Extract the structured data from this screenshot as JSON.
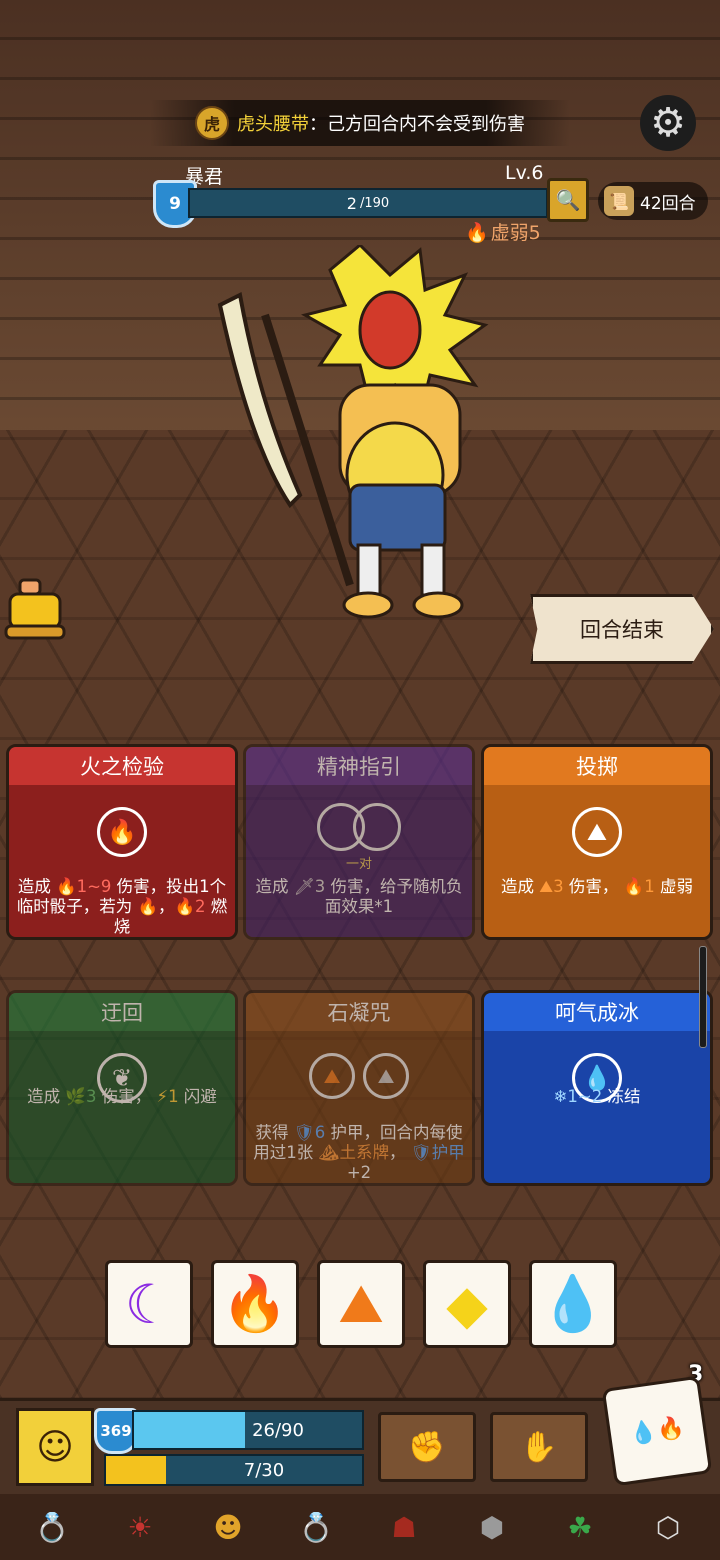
{
  "effect_banner": {
    "item_name": "虎头腰带",
    "separator": "：",
    "text": "己方回合内不会受到伤害"
  },
  "enemy": {
    "name": "暴君",
    "level": "Lv.6",
    "armor": "9",
    "hp_current": "2",
    "hp_max": "/190",
    "hp_fraction": 0.0105,
    "debuff": "虚弱5"
  },
  "turn_counter": "42回合",
  "end_turn_label": "回合结束",
  "cards": [
    {
      "title": "火之检验",
      "color": "#c63430",
      "icon": "fire-icon",
      "desc": [
        "造成 ",
        {
          "v": "1~9",
          "c": "hl-red",
          "i": "🔥"
        },
        " 伤害，投出1个临时骰子，若为 ",
        {
          "v": "",
          "c": "hl-red",
          "i": "🔥"
        },
        "，",
        {
          "v": "2",
          "c": "hl-red",
          "i": "🔥"
        },
        " 燃烧"
      ]
    },
    {
      "title": "精神指引",
      "color": "#5a2f8e",
      "icon": "pair-icon",
      "sub": "一对",
      "desc": [
        "造成 ",
        {
          "v": "3",
          "c": "hl-gray",
          "i": "🗡"
        },
        " 伤害，给予随机负面效果*1"
      ]
    },
    {
      "title": "投掷",
      "color": "#e1791f",
      "icon": "earth-icon",
      "desc": [
        "造成 ",
        {
          "v": "3",
          "c": "hl-or",
          "i": "⛰"
        },
        " 伤害， ",
        {
          "v": "1",
          "c": "hl-or",
          "i": "🔥"
        },
        " 虚弱"
      ]
    },
    {
      "title": "迂回",
      "color": "#1f7a3a",
      "icon": "wind-icon",
      "desc": [
        "造成 ",
        {
          "v": "3",
          "c": "hl-grn",
          "i": "🌿"
        },
        " 伤害， ",
        {
          "v": "1",
          "c": "hl-yel",
          "i": "⚡"
        },
        " 闪避"
      ]
    },
    {
      "title": "石凝咒",
      "color": "#8a4e1d",
      "icon": "earth-stone-icon",
      "desc": [
        "获得 ",
        {
          "v": "6",
          "c": "hl-blu",
          "i": "🛡"
        },
        " 护甲，回合内每使用过1张 ",
        {
          "v": "土系牌",
          "c": "hl-or",
          "i": "⛰"
        },
        "， ",
        {
          "v": "护甲",
          "c": "hl-blu",
          "i": "🛡"
        },
        " +2"
      ]
    },
    {
      "title": "呵气成冰",
      "color": "#2561d8",
      "icon": "water-icon",
      "desc": [
        {
          "v": "1~2",
          "c": "hl-ice",
          "i": "❄"
        },
        " 冻结"
      ]
    }
  ],
  "dice": [
    {
      "face": "moon-icon",
      "glyph": "☾",
      "color": "#8a2be2"
    },
    {
      "face": "fire-icon",
      "glyph": "🔥",
      "color": "#e5332a"
    },
    {
      "face": "earth-icon",
      "glyph": "⛰",
      "color": "#f07a1a"
    },
    {
      "face": "lightning-icon",
      "glyph": "◆",
      "color": "#f5d31a"
    },
    {
      "face": "water-icon",
      "glyph": "💧",
      "color": "#1d5fd6"
    }
  ],
  "player": {
    "armor": "369",
    "hp": "26/90",
    "hp_fraction": 0.289,
    "energy": "7/30",
    "energy_fraction": 0.233
  },
  "dice_remaining": "3",
  "relic_icons": [
    "ring-icon",
    "mask-icon",
    "tribal-mask-icon",
    "gem-ring-icon",
    "hood-icon",
    "stone-die-icon",
    "clover-icon",
    "crystal-die-icon"
  ]
}
